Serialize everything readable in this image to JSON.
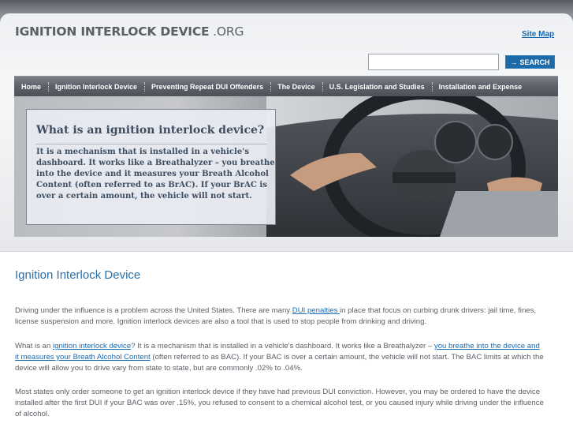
{
  "header": {
    "logo_bold": "IGNITION INTERLOCK DEVICE",
    "logo_suffix": " .ORG",
    "sitemap_label": "Site Map"
  },
  "search": {
    "value": "",
    "button_label": "SEARCH",
    "button_icon": "arrow-right-icon"
  },
  "nav": {
    "items": [
      {
        "label": "Home"
      },
      {
        "label": "Ignition Interlock Device"
      },
      {
        "label": "Preventing Repeat DUI Offenders"
      },
      {
        "label": "The Device"
      },
      {
        "label": "U.S. Legislation and Studies"
      },
      {
        "label": "Installation and Expense"
      }
    ]
  },
  "hero": {
    "title": "What is an ignition interlock device?",
    "text": "It is a mechanism that is installed in a vehicle's\ndashboard. It works like a Breathalyzer – you breathe\ninto the device and it measures your Breath Alcohol\nContent (often referred to as BrAC). If your BrAC is\nover a certain amount, the vehicle will not start."
  },
  "main": {
    "title": "Ignition Interlock Device",
    "p1": {
      "a": "Driving under the influence is a problem across the United States. There are many ",
      "link": "DUI penalties ",
      "b": "in place that focus on curbing drunk drivers: jail time, fines, license suspension and more. Ignition interlock devices are also a tool that is used to stop people from drinking and driving."
    },
    "p2": {
      "a": "What is an ",
      "link1": "ignition interlock device",
      "b": "? It is a mechanism that is installed in a vehicle's dashboard. It works like a Breathalyzer – ",
      "link2": "you breathe into the device and it measures your Breath Alcohol Content",
      "c": " (often referred to as BAC). If your BAC is over a certain amount, the vehicle will not start. The BAC limits at which the device will allow you to drive vary from state to state, but are commonly .02% to .04%."
    },
    "p3": "Most states only order someone to get an ignition interlock device if they have had previous DUI conviction. However, you may be ordered to have the device installed after the first DUI if your BAC was over .15%, you refused to consent to a chemical alcohol test, or you caused injury while driving under the influence of alcohol."
  }
}
